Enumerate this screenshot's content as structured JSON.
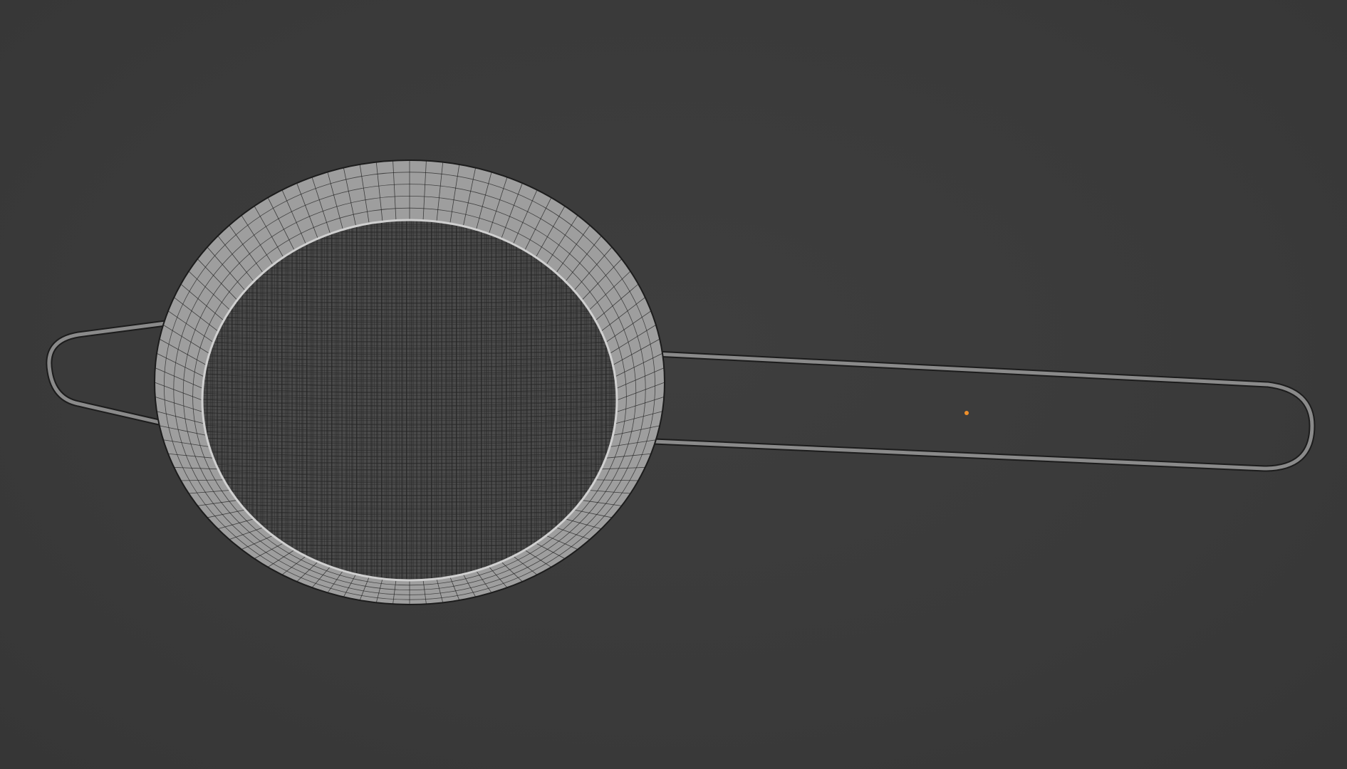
{
  "viewport": {
    "background_color": "#3b3b3b",
    "mesh_fill_color": "#9c9c9c",
    "mesh_dark_fill_color": "#404040",
    "wire_color": "#1c1c1c",
    "origin_color": "#f0902a"
  },
  "object": {
    "type": "wireframe-mesh",
    "subject": "tea-strainer-icon",
    "parts": [
      "rim",
      "mesh-basket",
      "handle-wire",
      "hook-wire"
    ]
  }
}
